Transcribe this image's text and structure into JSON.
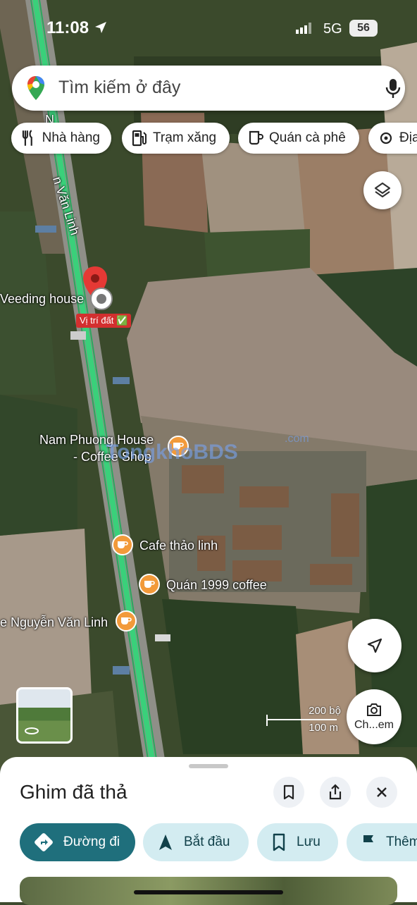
{
  "status_bar": {
    "time": "11:08",
    "network": "5G",
    "battery": "56"
  },
  "search": {
    "placeholder": "Tìm kiếm ở đây"
  },
  "chips": [
    {
      "label": "Nhà hàng",
      "icon": "restaurant-icon"
    },
    {
      "label": "Trạm xăng",
      "icon": "gas-station-icon"
    },
    {
      "label": "Quán cà phê",
      "icon": "coffee-icon"
    },
    {
      "label": "Địa",
      "icon": "attractions-icon"
    }
  ],
  "map": {
    "road_label_1": "N",
    "road_label_2": "n Văn Linh",
    "pin_place": "Veeding house",
    "pin_badge": "Vị trí đất ✅",
    "places": [
      {
        "name_line1": "Nam Phuong House",
        "name_line2": "- Coffee Shop"
      },
      {
        "name_line1": "Cafe thảo linh"
      },
      {
        "name_line1": "Quán 1999 coffee"
      },
      {
        "name_line1": "e Nguyễn Văn Linh"
      }
    ],
    "watermark": "TongkhoBDS",
    "watermark_small": ".com",
    "scale_top": "200 bộ",
    "scale_bottom": "100 m",
    "lens_label": "Ch...em"
  },
  "sheet": {
    "title": "Ghim đã thả",
    "actions": [
      {
        "label": "Đường đi"
      },
      {
        "label": "Bắt đầu"
      },
      {
        "label": "Lưu"
      },
      {
        "label": "Thêm"
      }
    ]
  },
  "colors": {
    "accent": "#1f6f7c",
    "chip_bg": "#d3ecf1",
    "route": "#3ad07a",
    "poi": "#f29a3a",
    "pin": "#e53935"
  }
}
